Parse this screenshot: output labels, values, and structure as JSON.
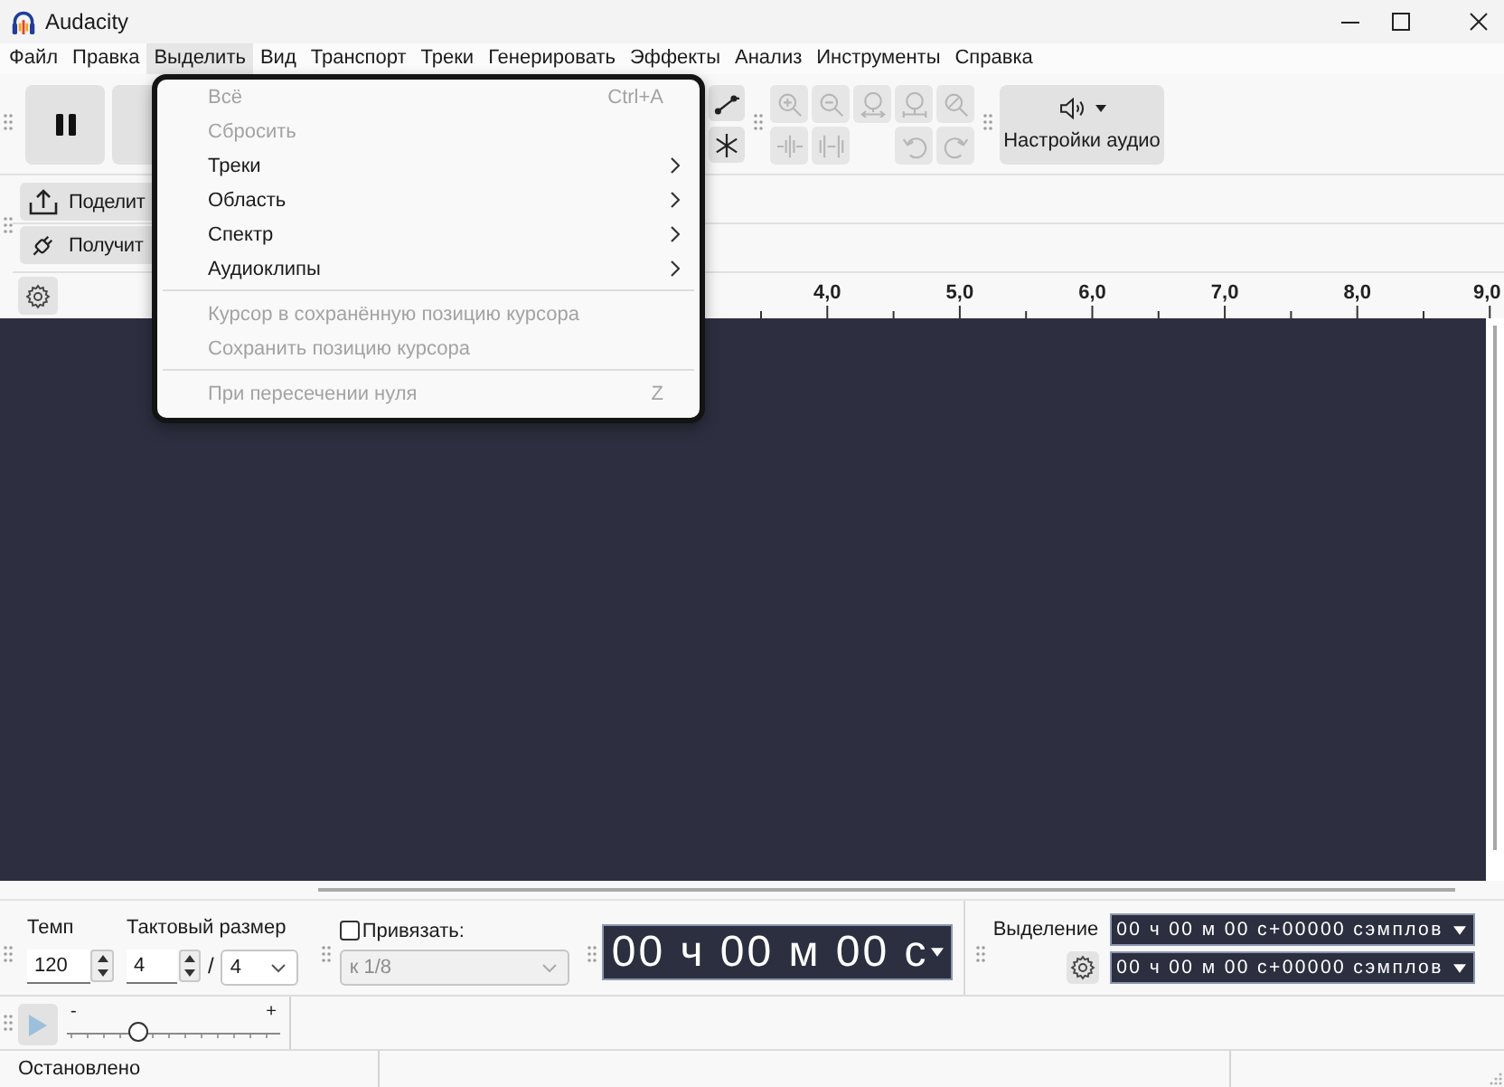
{
  "window": {
    "title": "Audacity"
  },
  "menu_bar": [
    {
      "label": "Файл",
      "selected": false
    },
    {
      "label": "Правка",
      "selected": false
    },
    {
      "label": "Выделить",
      "selected": true
    },
    {
      "label": "Вид",
      "selected": false
    },
    {
      "label": "Транспорт",
      "selected": false
    },
    {
      "label": "Треки",
      "selected": false
    },
    {
      "label": "Генерировать",
      "selected": false
    },
    {
      "label": "Эффекты",
      "selected": false
    },
    {
      "label": "Анализ",
      "selected": false
    },
    {
      "label": "Инструменты",
      "selected": false
    },
    {
      "label": "Справка",
      "selected": false
    }
  ],
  "open_menu": {
    "items": [
      {
        "kind": "item",
        "label": "Всё",
        "shortcut": "Ctrl+A",
        "disabled": true,
        "submenu": false
      },
      {
        "kind": "item",
        "label": "Сбросить",
        "disabled": true,
        "submenu": false
      },
      {
        "kind": "item",
        "label": "Треки",
        "disabled": false,
        "submenu": true
      },
      {
        "kind": "item",
        "label": "Область",
        "disabled": false,
        "submenu": true
      },
      {
        "kind": "item",
        "label": "Спектр",
        "disabled": false,
        "submenu": true
      },
      {
        "kind": "item",
        "label": "Аудиоклипы",
        "disabled": false,
        "submenu": true
      },
      {
        "kind": "separator"
      },
      {
        "kind": "item",
        "label": "Курсор в сохранённую позицию курсора",
        "disabled": true,
        "submenu": false
      },
      {
        "kind": "item",
        "label": "Сохранить позицию курсора",
        "disabled": true,
        "submenu": false
      },
      {
        "kind": "separator"
      },
      {
        "kind": "item",
        "label": "При пересечении нуля",
        "shortcut": "Z",
        "disabled": true,
        "submenu": false
      }
    ]
  },
  "edit_toolbar": {
    "disabled": true
  },
  "audio_setup_button": {
    "label": "Настройки аудио"
  },
  "share_toolbar": {
    "share_button": "Поделит",
    "get_button": "Получит"
  },
  "ruler": {
    "labels": [
      "4,0",
      "5,0",
      "6,0",
      "7,0",
      "8,0",
      "9,0"
    ]
  },
  "tempo": {
    "label": "Темп",
    "value": "120"
  },
  "time_signature": {
    "label": "Тактовый размер",
    "upper": "4",
    "divider": "/",
    "lower": "4"
  },
  "snap": {
    "label": "Привязать:",
    "checked": false,
    "value": "к 1/8",
    "disabled": true
  },
  "time_display": {
    "value": "00 ч 00 м 00 с"
  },
  "selection": {
    "label": "Выделение",
    "start": "00 ч 00 м 00 с+00000 сэмплов",
    "end": "00 ч 00 м 00 с+00000 сэмплов"
  },
  "play_at_speed": {
    "disabled": true,
    "min_label": "-",
    "max_label": "+",
    "level": 0.32
  },
  "status_bar": {
    "text": "Остановлено"
  }
}
